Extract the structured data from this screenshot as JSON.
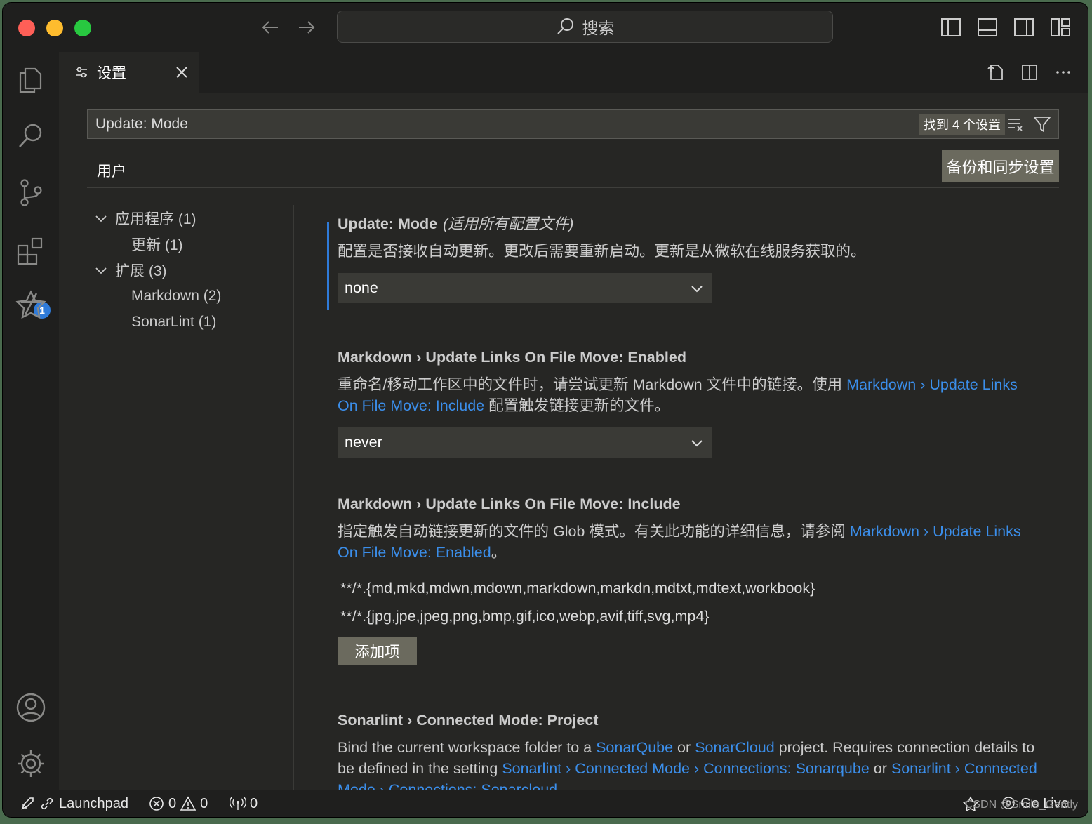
{
  "titlebar": {
    "search_label": "搜索",
    "icons": [
      "back-arrow-icon",
      "forward-arrow-icon",
      "toggle-primary-sidebar-icon",
      "toggle-panel-icon",
      "toggle-secondary-sidebar-icon",
      "customize-layout-icon"
    ]
  },
  "activitybar": {
    "icons": [
      "explorer-icon",
      "search-icon",
      "source-control-icon",
      "extensions-icon",
      "sonarlint-icon",
      "accounts-icon",
      "manage-gear-icon"
    ],
    "extensions_badge": "1"
  },
  "tab": {
    "label": "设置"
  },
  "settings_search": {
    "value": "Update: Mode",
    "found_label": "找到 4 个设置"
  },
  "scope_tab": "用户",
  "backup_button": "备份和同步设置",
  "toc": {
    "items": [
      {
        "label": "应用程序 (1)"
      },
      {
        "label": "更新 (1)"
      },
      {
        "label": "扩展 (3)"
      },
      {
        "label": "Markdown (2)"
      },
      {
        "label": "SonarLint (1)"
      }
    ]
  },
  "settings": {
    "update_mode": {
      "prefix": "Update: ",
      "name": "Mode",
      "scope": "(适用所有配置文件)",
      "description": "配置是否接收自动更新。更改后需要重新启动。更新是从微软在线服务获取的。",
      "value": "none"
    },
    "md_enabled": {
      "prefix": "Markdown › Update Links On File Move: ",
      "name": "Enabled",
      "desc_before": "重命名/移动工作区中的文件时，请尝试更新 Markdown 文件中的链接。使用 ",
      "desc_link": "Markdown › Update Links On File Move: Include",
      "desc_after": " 配置触发链接更新的文件。",
      "value": "never"
    },
    "md_include": {
      "prefix": "Markdown › Update Links On File Move: ",
      "name": "Include",
      "desc_before": "指定触发自动链接更新的文件的 Glob 模式。有关此功能的详细信息，请参阅 ",
      "desc_link": "Markdown › Update Links On File Move: Enabled",
      "desc_after": "。",
      "globs": [
        "**/*.{md,mkd,mdwn,mdown,markdown,markdn,mdtxt,mdtext,workbook}",
        "**/*.{jpg,jpe,jpeg,png,bmp,gif,ico,webp,avif,tiff,svg,mp4}"
      ],
      "add_button": "添加项"
    },
    "sonar_project": {
      "prefix": "Sonarlint › Connected Mode: ",
      "name": "Project",
      "d1": "Bind the current workspace folder to a ",
      "l1": "SonarQube",
      "d2": " or ",
      "l2": "SonarCloud",
      "d3": " project. Requires connection details to be defined in the setting ",
      "l3": "Sonarlint › Connected Mode › Connections: Sonarqube",
      "d4": " or ",
      "l4": "Sonarlint › Connected Mode › Connections: Sonarcloud"
    }
  },
  "statusbar": {
    "launchpad": "Launchpad",
    "errors": "0",
    "warnings": "0",
    "ports": "0",
    "go_live": "Go Live",
    "watermark": "CSDN @Smile_Gently"
  },
  "colors": {
    "accent": "#2f7bd9",
    "link": "#3b8eea",
    "background": "#262624",
    "chrome": "#1f1f1e"
  }
}
